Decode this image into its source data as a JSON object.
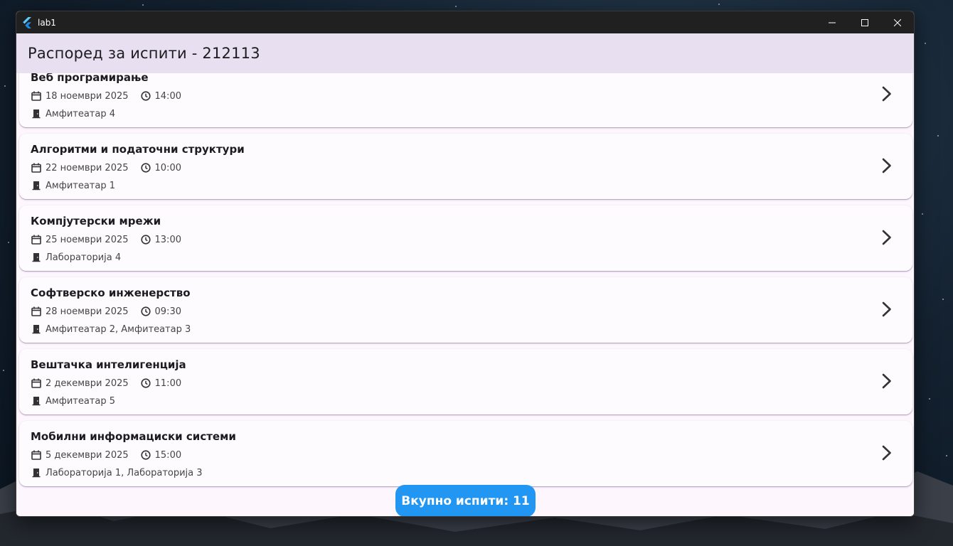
{
  "window": {
    "title": "lab1",
    "controls": {
      "minimize": "minimize-icon",
      "maximize": "maximize-icon",
      "close": "close-icon"
    }
  },
  "appbar": {
    "title": "Распоред за испити - 212113"
  },
  "exams": [
    {
      "name": "Веб програмирање",
      "date": "18 ноември 2025",
      "time": "14:00",
      "room": "Амфитеатар 4"
    },
    {
      "name": "Алгоритми и податочни структури",
      "date": "22 ноември 2025",
      "time": "10:00",
      "room": "Амфитеатар 1"
    },
    {
      "name": "Компјутерски мрежи",
      "date": "25 ноември 2025",
      "time": "13:00",
      "room": "Лабораторија 4"
    },
    {
      "name": "Софтверско инженерство",
      "date": "28 ноември 2025",
      "time": "09:30",
      "room": "Амфитеатар 2, Амфитеатар 3"
    },
    {
      "name": "Вештачка интелигенција",
      "date": "2 декември 2025",
      "time": "11:00",
      "room": "Амфитеатар 5"
    },
    {
      "name": "Мобилни информациски системи",
      "date": "5 декември 2025",
      "time": "15:00",
      "room": "Лабораторија 1, Лабораторија 3"
    }
  ],
  "footer": {
    "total_label": "Вкупно испити: 11"
  },
  "colors": {
    "accent": "#2196f3",
    "appbar": "#e8e0f0",
    "surface": "#fdf6fd",
    "titlebar": "#202020"
  },
  "icons": {
    "date": "calendar-icon",
    "time": "clock-icon",
    "room": "door-icon",
    "open": "chevron-right-icon"
  }
}
